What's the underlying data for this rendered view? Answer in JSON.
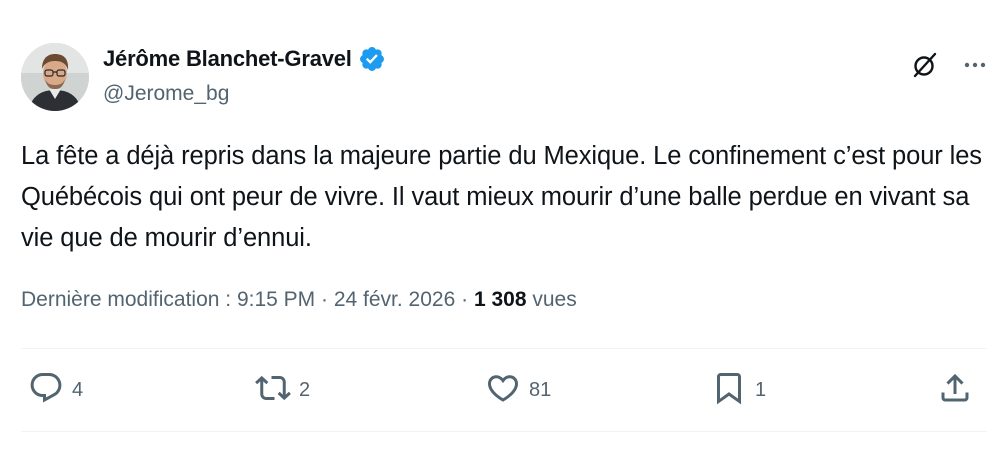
{
  "author": {
    "display_name": "Jérôme Blanchet-Gravel",
    "handle": "@Jerome_bg",
    "verified": true
  },
  "tweet": {
    "text": "La fête a déjà repris dans la majeure partie du Mexique. Le confinement c’est pour les Québécois qui ont peur de vivre. Il vaut mieux mourir d’une balle perdue en vivant sa vie que de mourir d’ennui."
  },
  "meta": {
    "edited_label": "Dernière modification :",
    "time": "9:15 PM",
    "separator": "·",
    "date": "24 févr. 2026",
    "views_count": "1 308",
    "views_label": "vues"
  },
  "actions": {
    "replies": "4",
    "reposts": "2",
    "likes": "81",
    "bookmarks": "1"
  },
  "icons": {
    "verified": "verified-badge-icon",
    "grok": "grok-icon",
    "more": "more-icon",
    "reply": "reply-icon",
    "repost": "repost-icon",
    "like": "like-icon",
    "bookmark": "bookmark-icon",
    "share": "share-icon"
  },
  "colors": {
    "verified": "#1d9bf0",
    "text": "#0f1419",
    "secondary": "#536471",
    "divider": "#eff3f4"
  }
}
